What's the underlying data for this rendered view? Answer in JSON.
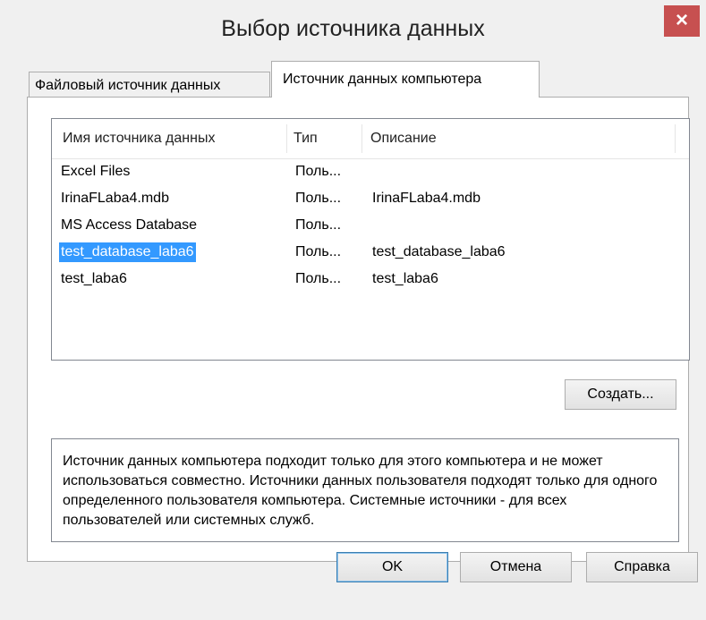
{
  "window": {
    "title": "Выбор источника данных",
    "close_glyph": "×"
  },
  "tabs": [
    {
      "label": "Файловый источник данных",
      "active": false
    },
    {
      "label": "Источник данных компьютера",
      "active": true
    }
  ],
  "list": {
    "columns": [
      "Имя источника данных",
      "Тип",
      "Описание"
    ],
    "rows": [
      {
        "name": "Excel Files",
        "type": "Поль...",
        "desc": ""
      },
      {
        "name": "IrinaFLaba4.mdb",
        "type": "Поль...",
        "desc": "IrinaFLaba4.mdb"
      },
      {
        "name": "MS Access Database",
        "type": "Поль...",
        "desc": ""
      },
      {
        "name": "test_database_laba6",
        "type": "Поль...",
        "desc": "test_database_laba6",
        "selected": true
      },
      {
        "name": "test_laba6",
        "type": "Поль...",
        "desc": "test_laba6"
      }
    ]
  },
  "buttons": {
    "create": "Создать...",
    "ok": "OK",
    "cancel": "Отмена",
    "help": "Справка"
  },
  "info_text": "Источник данных компьютера подходит только для этого компьютера и не может использоваться совместно. Источники данных пользователя подходят только для одного определенного пользователя компьютера. Системные источники - для всех пользователей или системных служб.",
  "colors": {
    "accent": "#3399ff",
    "close": "#c75050"
  }
}
